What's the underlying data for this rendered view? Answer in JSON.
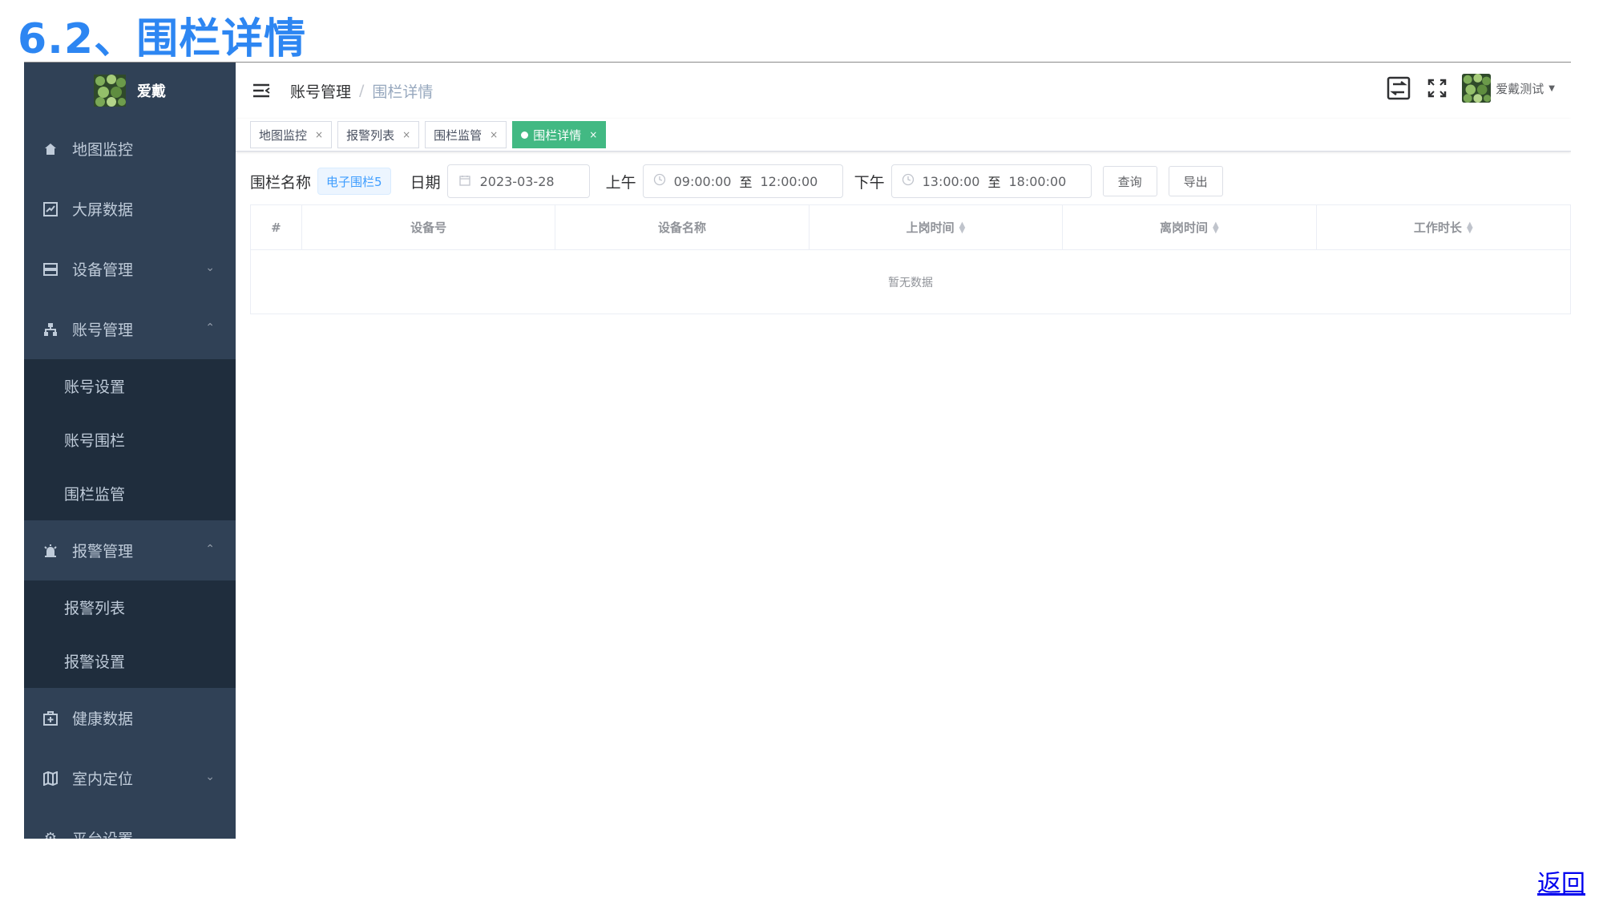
{
  "doc_title": "6.2、围栏详情",
  "sidebar": {
    "logo_text": "爱戴",
    "items": [
      {
        "label": "地图监控",
        "icon": "home-icon"
      },
      {
        "label": "大屏数据",
        "icon": "chart-icon"
      },
      {
        "label": "设备管理",
        "icon": "server-icon",
        "arrow": "down"
      },
      {
        "label": "账号管理",
        "icon": "tree-icon",
        "arrow": "up",
        "children": [
          "账号设置",
          "账号围栏",
          "围栏监管"
        ]
      },
      {
        "label": "报警管理",
        "icon": "alarm-icon",
        "arrow": "up",
        "children": [
          "报警列表",
          "报警设置"
        ]
      },
      {
        "label": "健康数据",
        "icon": "medical-icon"
      },
      {
        "label": "室内定位",
        "icon": "map-icon",
        "arrow": "down"
      },
      {
        "label": "平台设置",
        "icon": "gear-icon"
      }
    ]
  },
  "navbar": {
    "breadcrumb": [
      "账号管理",
      "围栏详情"
    ],
    "separator": "/",
    "user_name": "爱戴测试"
  },
  "tags": [
    {
      "label": "地图监控",
      "active": false
    },
    {
      "label": "报警列表",
      "active": false
    },
    {
      "label": "围栏监管",
      "active": false
    },
    {
      "label": "围栏详情",
      "active": true
    }
  ],
  "filter": {
    "fence_label": "围栏名称",
    "fence_value": "电子围栏5",
    "date_label": "日期",
    "date_value": "2023-03-28",
    "am_label": "上午",
    "am_start": "09:00:00",
    "am_end": "12:00:00",
    "pm_label": "下午",
    "pm_start": "13:00:00",
    "pm_end": "18:00:00",
    "range_sep": "至",
    "query_button": "查询",
    "export_button": "导出"
  },
  "table": {
    "columns": [
      "#",
      "设备号",
      "设备名称",
      "上岗时间",
      "离岗时间",
      "工作时长"
    ],
    "empty_text": "暂无数据"
  },
  "back_link": "返回",
  "colors": {
    "sidebar_bg": "#304156",
    "active_tag": "#42b983",
    "title": "#2d86f2"
  }
}
